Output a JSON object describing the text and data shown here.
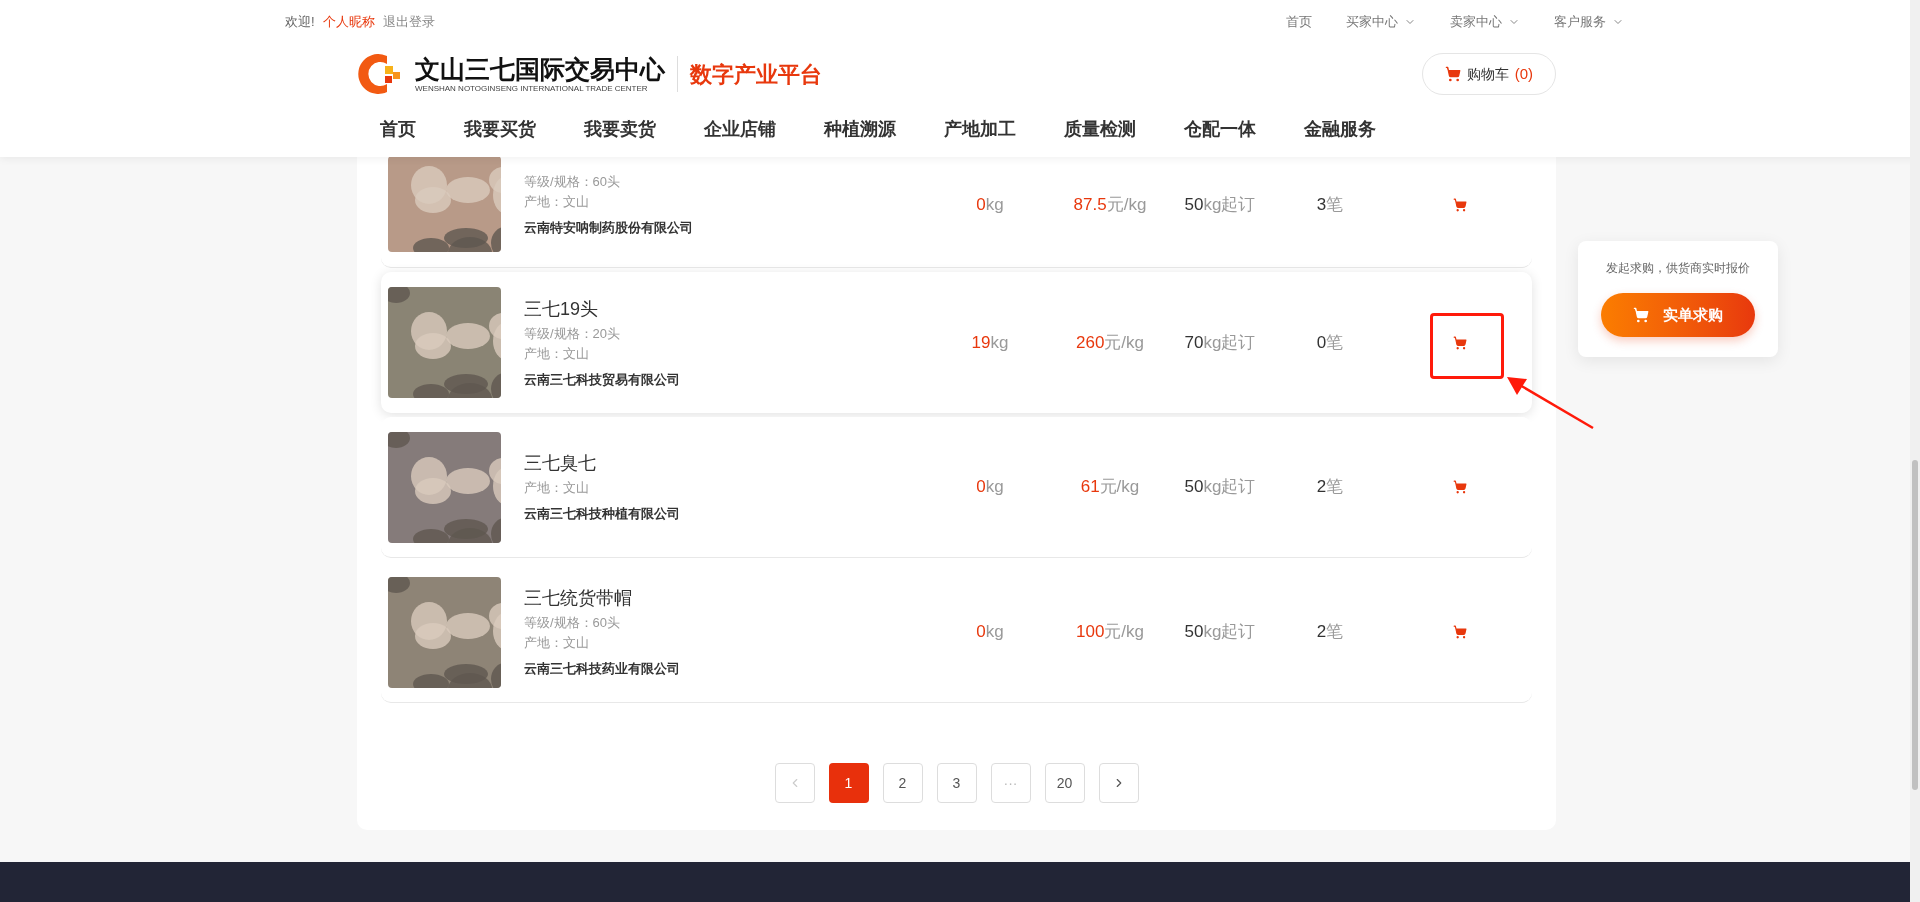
{
  "top_bar": {
    "welcome": "欢迎!",
    "nickname": "个人昵称",
    "logout": "退出登录",
    "links": [
      {
        "label": "首页",
        "dropdown": false
      },
      {
        "label": "买家中心",
        "dropdown": true
      },
      {
        "label": "卖家中心",
        "dropdown": true
      },
      {
        "label": "客户服务",
        "dropdown": true
      }
    ]
  },
  "brand": {
    "title": "文山三七国际交易中心",
    "subtitle": "WENSHAN NOTOGINSENG INTERNATIONAL TRADE CENTER",
    "platform": "数字产业平台"
  },
  "cart": {
    "label": "购物车",
    "count": "(0)"
  },
  "nav": [
    {
      "label": "首页"
    },
    {
      "label": "我要买货"
    },
    {
      "label": "我要卖货"
    },
    {
      "label": "企业店铺"
    },
    {
      "label": "种植溯源"
    },
    {
      "label": "产地加工"
    },
    {
      "label": "质量检测"
    },
    {
      "label": "仓配一体"
    },
    {
      "label": "金融服务"
    }
  ],
  "products": [
    {
      "partial": true,
      "highlighted": false,
      "annotated": false,
      "grade": "等级/规格：60头",
      "origin": "产地：文山",
      "company": "云南特安呐制药股份有限公司",
      "stock": "0",
      "stock_unit": "kg",
      "price": "87.5",
      "price_unit": "元/kg",
      "moq": "50",
      "moq_unit": "kg起订",
      "orders": "3",
      "orders_unit": "笔"
    },
    {
      "partial": false,
      "highlighted": true,
      "annotated": true,
      "name": "三七19头",
      "grade": "等级/规格：20头",
      "origin": "产地：文山",
      "company": "云南三七科技贸易有限公司",
      "stock": "19",
      "stock_unit": "kg",
      "price": "260",
      "price_unit": "元/kg",
      "moq": "70",
      "moq_unit": "kg起订",
      "orders": "0",
      "orders_unit": "笔"
    },
    {
      "partial": false,
      "highlighted": false,
      "annotated": false,
      "name": "三七臭七",
      "origin": "产地：文山",
      "company": "云南三七科技种植有限公司",
      "stock": "0",
      "stock_unit": "kg",
      "price": "61",
      "price_unit": "元/kg",
      "moq": "50",
      "moq_unit": "kg起订",
      "orders": "2",
      "orders_unit": "笔"
    },
    {
      "partial": false,
      "highlighted": false,
      "annotated": false,
      "name": "三七统货带帽",
      "grade": "等级/规格：60头",
      "origin": "产地：文山",
      "company": "云南三七科技药业有限公司",
      "stock": "0",
      "stock_unit": "kg",
      "price": "100",
      "price_unit": "元/kg",
      "moq": "50",
      "moq_unit": "kg起订",
      "orders": "2",
      "orders_unit": "笔"
    }
  ],
  "pagination": {
    "prev_disabled": true,
    "pages": [
      {
        "kind": "page",
        "label": "1",
        "selected": true
      },
      {
        "kind": "page",
        "label": "2",
        "selected": false
      },
      {
        "kind": "page",
        "label": "3",
        "selected": false
      },
      {
        "kind": "ellipsis",
        "label": "···",
        "selected": false
      },
      {
        "kind": "page",
        "label": "20",
        "selected": false
      }
    ]
  },
  "side_card": {
    "text": "发起求购，供货商实时报价",
    "button": "实单求购"
  }
}
